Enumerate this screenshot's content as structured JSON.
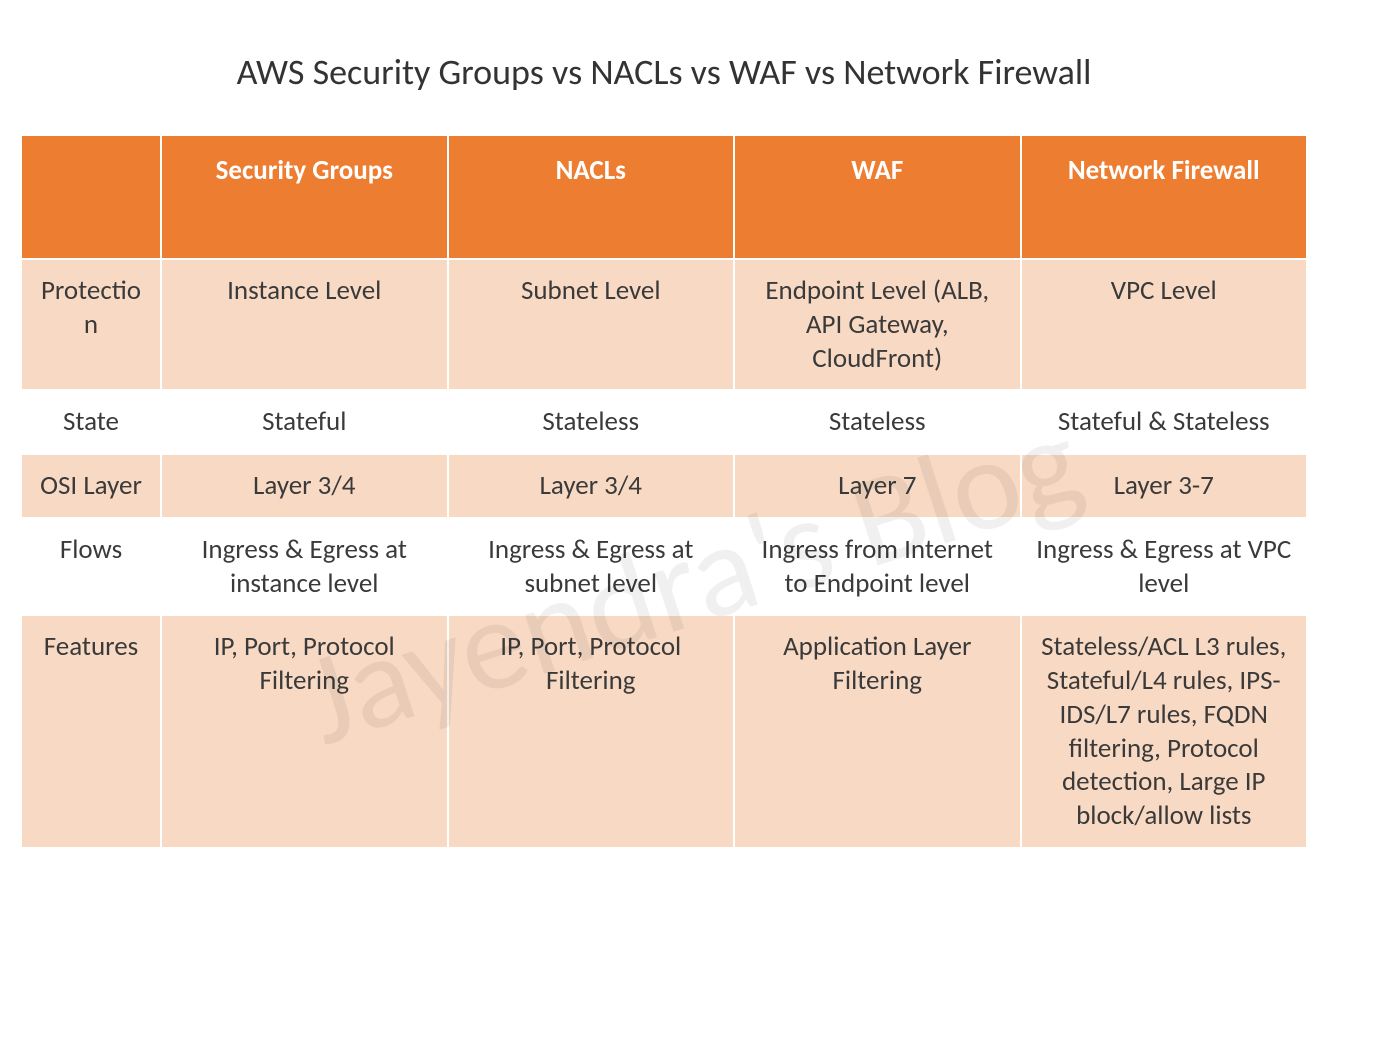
{
  "title": "AWS Security Groups vs NACLs vs WAF vs Network Firewall",
  "watermark": "Jayendra's Blog",
  "headers": {
    "blank": "",
    "col1": "Security Groups",
    "col2": "NACLs",
    "col3": "WAF",
    "col4": "Network Firewall"
  },
  "rows": [
    {
      "label": "Protection",
      "c1": "Instance Level",
      "c2": "Subnet Level",
      "c3": "Endpoint Level (ALB, API Gateway, CloudFront)",
      "c4": "VPC Level"
    },
    {
      "label": "State",
      "c1": "Stateful",
      "c2": "Stateless",
      "c3": "Stateless",
      "c4": "Stateful & Stateless"
    },
    {
      "label": "OSI Layer",
      "c1": "Layer 3/4",
      "c2": "Layer 3/4",
      "c3": "Layer 7",
      "c4": "Layer 3-7"
    },
    {
      "label": "Flows",
      "c1": "Ingress & Egress at instance level",
      "c2": "Ingress & Egress at subnet level",
      "c3": "Ingress from Internet to Endpoint level",
      "c4": "Ingress & Egress at VPC level"
    },
    {
      "label": "Features",
      "c1": "IP, Port, Protocol Filtering",
      "c2": "IP, Port, Protocol Filtering",
      "c3": "Application Layer Filtering",
      "c4": "Stateless/ACL L3 rules, Stateful/L4 rules, IPS-IDS/L7 rules, FQDN filtering, Protocol detection, Large IP block/allow lists"
    }
  ]
}
